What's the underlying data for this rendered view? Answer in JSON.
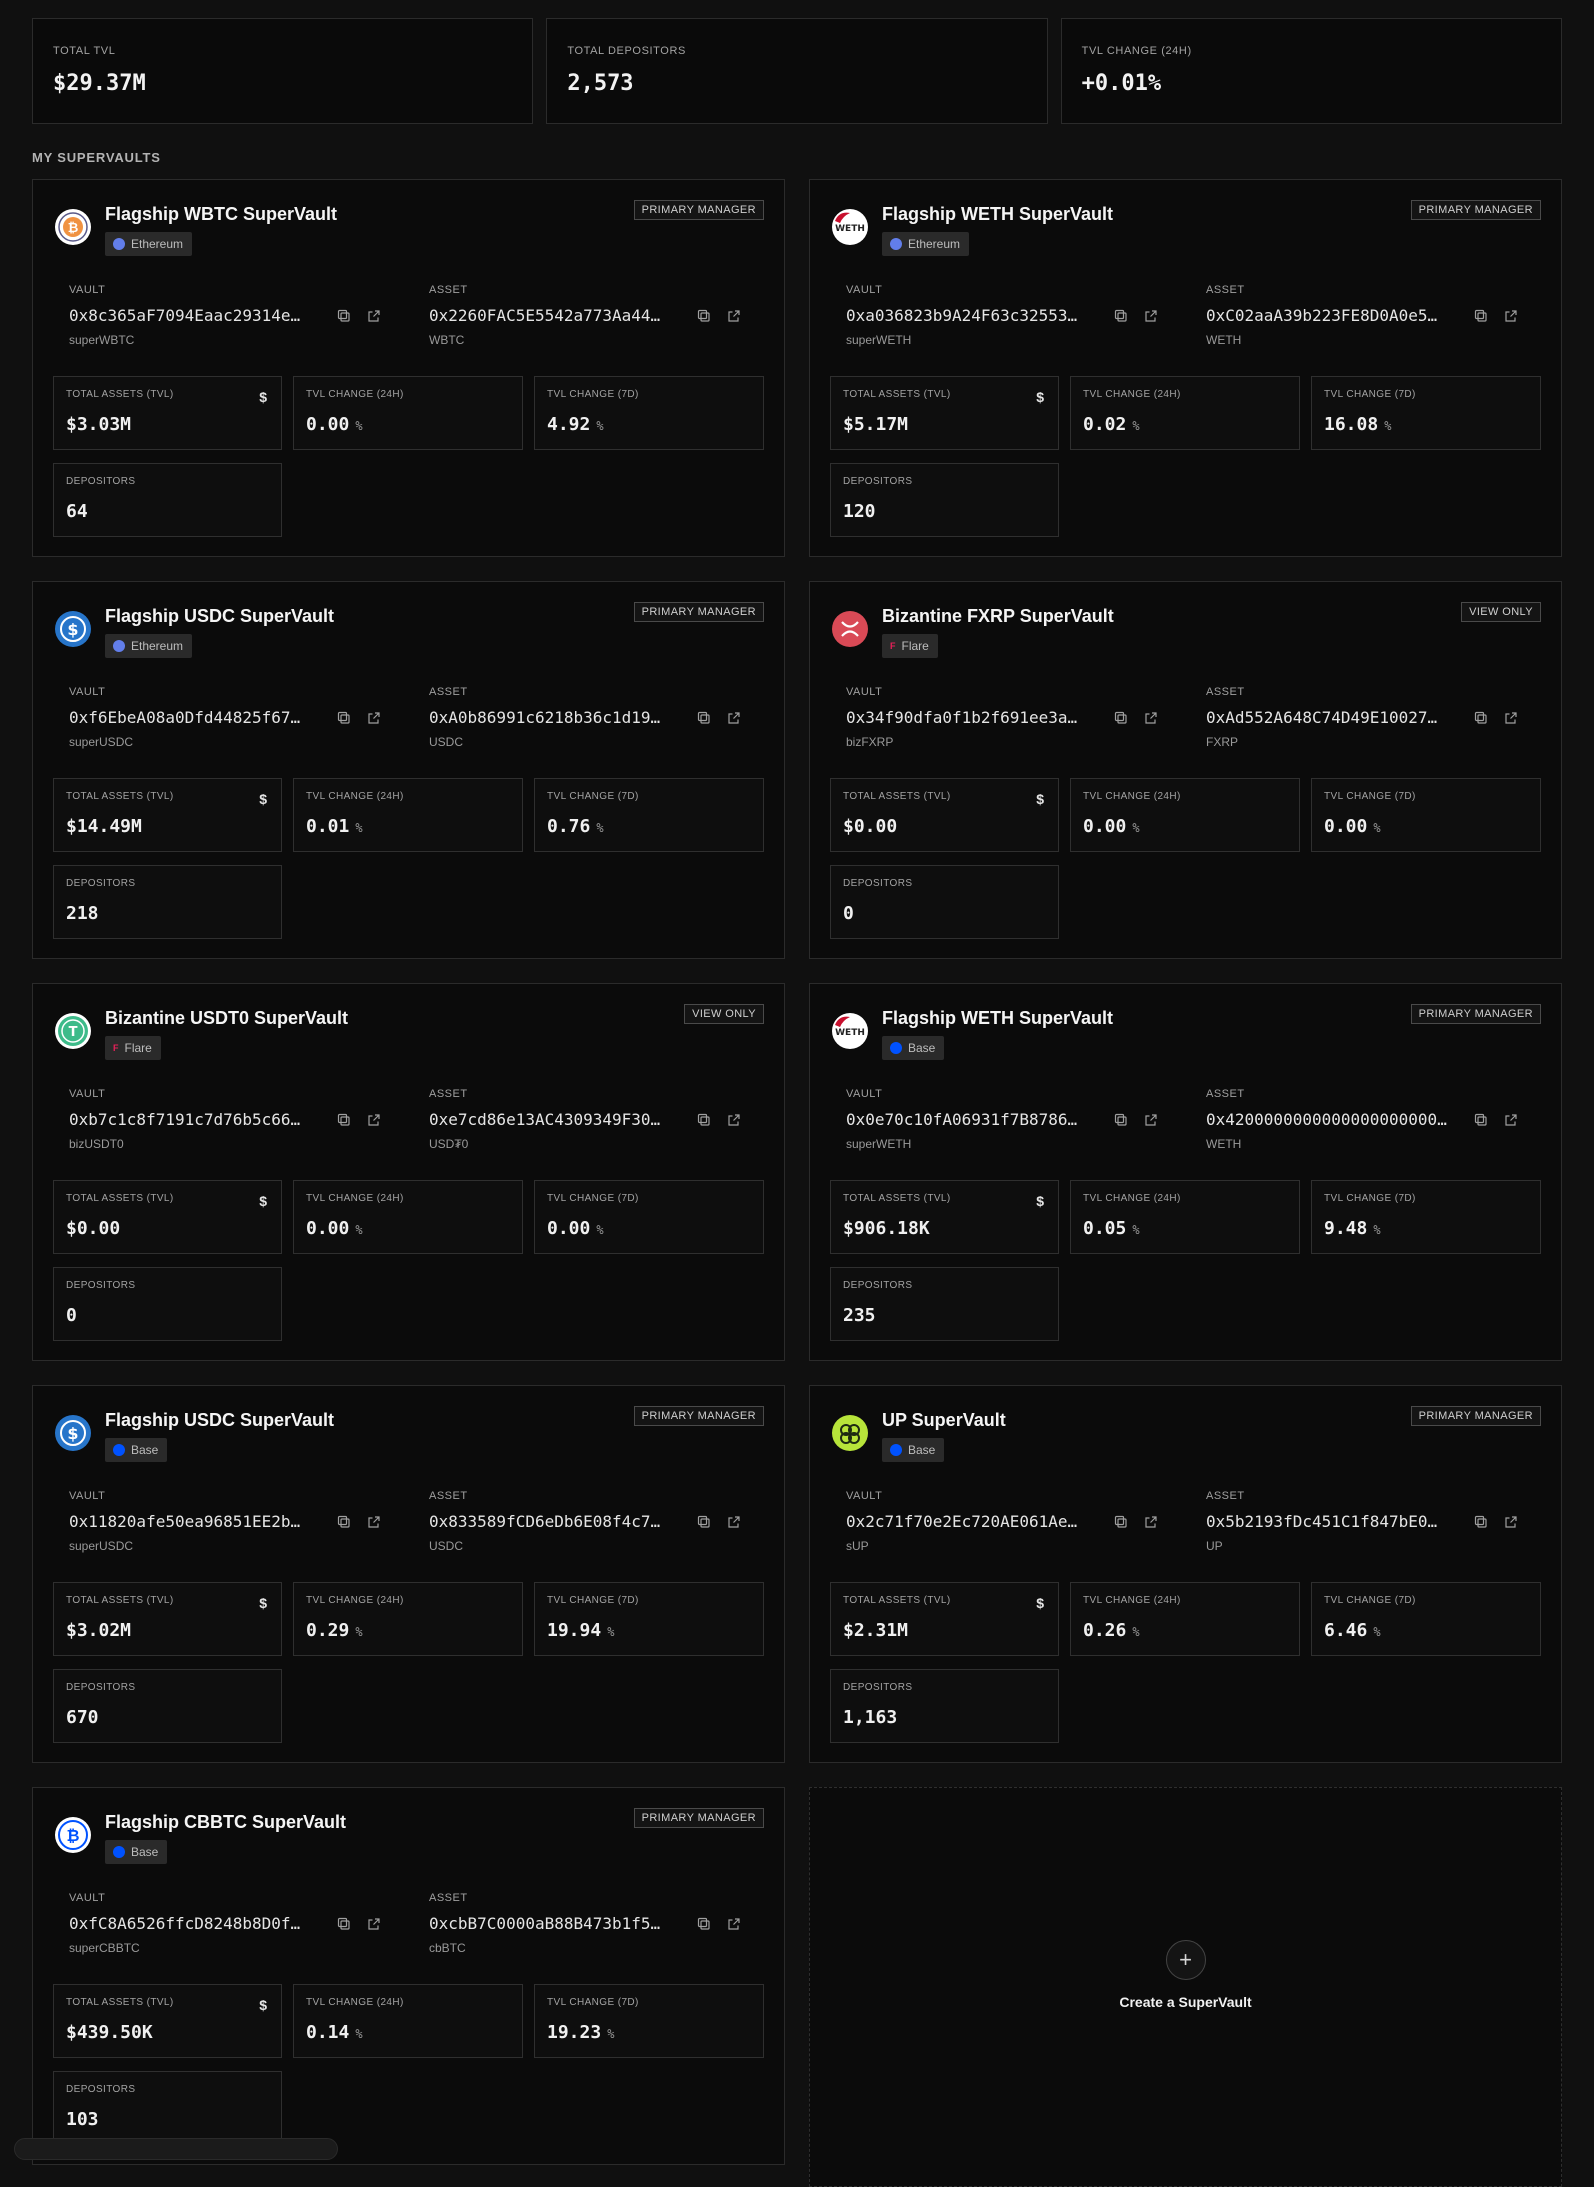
{
  "summary": [
    {
      "label": "TOTAL TVL",
      "value": "$29.37M"
    },
    {
      "label": "TOTAL DEPOSITORS",
      "value": "2,573"
    },
    {
      "label": "TVL CHANGE (24H)",
      "value": "+0.01%"
    }
  ],
  "section_title": "MY SUPERVAULTS",
  "labels": {
    "vault": "VAULT",
    "asset": "ASSET",
    "total_assets": "TOTAL ASSETS (TVL)",
    "tvl_24h": "TVL CHANGE (24H)",
    "tvl_7d": "TVL CHANGE (7D)",
    "depositors": "DEPOSITORS",
    "percent_unit": "%",
    "dollar_icon": "$"
  },
  "vaults": [
    {
      "name": "Flagship WBTC SuperVault",
      "chain": "Ethereum",
      "role": "PRIMARY MANAGER",
      "icon": "wbtc-icon",
      "vault_address": "0x8c365aF7094Eaac29314e…",
      "vault_symbol": "superWBTC",
      "asset_address": "0x2260FAC5E5542a773Aa44…",
      "asset_symbol": "WBTC",
      "tvl": "$3.03M",
      "change_24h": "0.00",
      "change_7d": "4.92",
      "depositors": "64"
    },
    {
      "name": "Flagship WETH SuperVault",
      "chain": "Ethereum",
      "role": "PRIMARY MANAGER",
      "icon": "weth-icon",
      "vault_address": "0xa036823b9A24F63c32553…",
      "vault_symbol": "superWETH",
      "asset_address": "0xC02aaA39b223FE8D0A0e5…",
      "asset_symbol": "WETH",
      "tvl": "$5.17M",
      "change_24h": "0.02",
      "change_7d": "16.08",
      "depositors": "120"
    },
    {
      "name": "Flagship USDC SuperVault",
      "chain": "Ethereum",
      "role": "PRIMARY MANAGER",
      "icon": "usdc-icon",
      "vault_address": "0xf6EbeA08a0Dfd44825f67…",
      "vault_symbol": "superUSDC",
      "asset_address": "0xA0b86991c6218b36c1d19…",
      "asset_symbol": "USDC",
      "tvl": "$14.49M",
      "change_24h": "0.01",
      "change_7d": "0.76",
      "depositors": "218"
    },
    {
      "name": "Bizantine FXRP SuperVault",
      "chain": "Flare",
      "role": "VIEW ONLY",
      "icon": "fxrp-icon",
      "vault_address": "0x34f90dfa0f1b2f691ee3a…",
      "vault_symbol": "bizFXRP",
      "asset_address": "0xAd552A648C74D49E10027…",
      "asset_symbol": "FXRP",
      "tvl": "$0.00",
      "change_24h": "0.00",
      "change_7d": "0.00",
      "depositors": "0"
    },
    {
      "name": "Bizantine USDT0 SuperVault",
      "chain": "Flare",
      "role": "VIEW ONLY",
      "icon": "usdt0-icon",
      "vault_address": "0xb7c1c8f7191c7d76b5c66…",
      "vault_symbol": "bizUSDT0",
      "asset_address": "0xe7cd86e13AC4309349F30…",
      "asset_symbol": "USD₮0",
      "tvl": "$0.00",
      "change_24h": "0.00",
      "change_7d": "0.00",
      "depositors": "0"
    },
    {
      "name": "Flagship WETH SuperVault",
      "chain": "Base",
      "role": "PRIMARY MANAGER",
      "icon": "weth-icon",
      "vault_address": "0x0e70c10fA06931f7B8786…",
      "vault_symbol": "superWETH",
      "asset_address": "0x4200000000000000000000…",
      "asset_symbol": "WETH",
      "tvl": "$906.18K",
      "change_24h": "0.05",
      "change_7d": "9.48",
      "depositors": "235"
    },
    {
      "name": "Flagship USDC SuperVault",
      "chain": "Base",
      "role": "PRIMARY MANAGER",
      "icon": "usdc-icon",
      "vault_address": "0x11820afe50ea96851EE2b…",
      "vault_symbol": "superUSDC",
      "asset_address": "0x833589fCD6eDb6E08f4c7…",
      "asset_symbol": "USDC",
      "tvl": "$3.02M",
      "change_24h": "0.29",
      "change_7d": "19.94",
      "depositors": "670"
    },
    {
      "name": "UP SuperVault",
      "chain": "Base",
      "role": "PRIMARY MANAGER",
      "icon": "up-icon",
      "vault_address": "0x2c71f70e2Ec720AE061Ae…",
      "vault_symbol": "sUP",
      "asset_address": "0x5b2193fDc451C1f847bE0…",
      "asset_symbol": "UP",
      "tvl": "$2.31M",
      "change_24h": "0.26",
      "change_7d": "6.46",
      "depositors": "1,163"
    },
    {
      "name": "Flagship CBBTC SuperVault",
      "chain": "Base",
      "role": "PRIMARY MANAGER",
      "icon": "cbbtc-icon",
      "vault_address": "0xfC8A6526ffcD8248b8D0f…",
      "vault_symbol": "superCBBTC",
      "asset_address": "0xcbB7C0000aB88B473b1f5…",
      "asset_symbol": "cbBTC",
      "tvl": "$439.50K",
      "change_24h": "0.14",
      "change_7d": "19.23",
      "depositors": "103"
    }
  ],
  "create": {
    "label": "Create a SuperVault",
    "icon": "plus-icon"
  },
  "colors": {
    "background": "#101010",
    "card": "#0b0b0b",
    "border": "#2b2b2b",
    "ethereum": "#627eea",
    "base": "#0052ff",
    "flare": "#e62058"
  }
}
